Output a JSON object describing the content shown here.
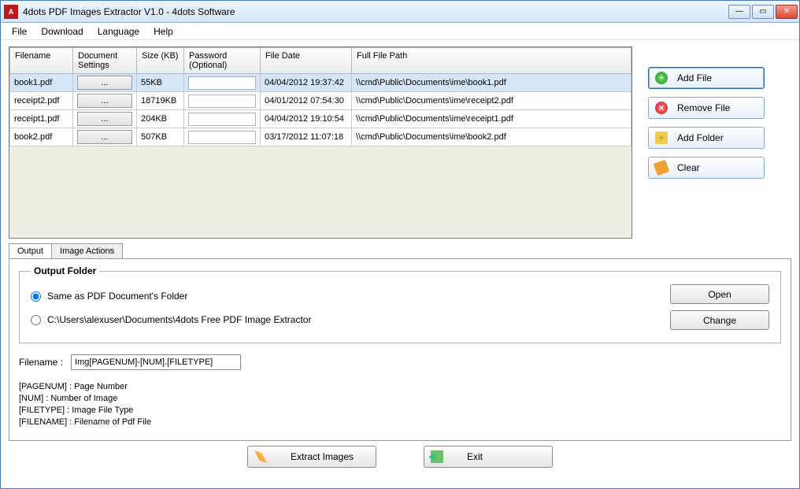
{
  "window": {
    "title": "4dots PDF Images Extractor V1.0 - 4dots Software",
    "icon_text": "A"
  },
  "menu": [
    "File",
    "Download",
    "Language",
    "Help"
  ],
  "grid": {
    "headers": {
      "filename": "Filename",
      "docsettings": "Document Settings",
      "size": "Size (KB)",
      "password": "Password (Optional)",
      "filedate": "File Date",
      "fullpath": "Full File Path"
    },
    "docsettings_btn": "...",
    "rows": [
      {
        "filename": "book1.pdf",
        "size": "55KB",
        "date": "04/04/2012 19:37:42",
        "path": "\\\\cmd\\Public\\Documents\\ime\\book1.pdf"
      },
      {
        "filename": "receipt2.pdf",
        "size": "18719KB",
        "date": "04/01/2012 07:54:30",
        "path": "\\\\cmd\\Public\\Documents\\ime\\receipt2.pdf"
      },
      {
        "filename": "receipt1.pdf",
        "size": "204KB",
        "date": "04/04/2012 19:10:54",
        "path": "\\\\cmd\\Public\\Documents\\ime\\receipt1.pdf"
      },
      {
        "filename": "book2.pdf",
        "size": "507KB",
        "date": "03/17/2012 11:07:18",
        "path": "\\\\cmd\\Public\\Documents\\ime\\book2.pdf"
      }
    ]
  },
  "sidebuttons": {
    "add_file": "Add File",
    "remove_file": "Remove File",
    "add_folder": "Add Folder",
    "clear": "Clear"
  },
  "tabs": {
    "output": "Output",
    "image_actions": "Image Actions"
  },
  "output": {
    "legend": "Output Folder",
    "same_as": "Same as PDF Document's Folder",
    "custom_path": "C:\\Users\\alexuser\\Documents\\4dots Free PDF Image Extractor",
    "open": "Open",
    "change": "Change",
    "filename_label": "Filename :",
    "filename_value": "Img[PAGENUM]-[NUM].[FILETYPE]",
    "hints": [
      "[PAGENUM] : Page Number",
      "[NUM] : Number of Image",
      "[FILETYPE] : Image File Type",
      "[FILENAME] : Filename of Pdf File"
    ]
  },
  "bottom": {
    "extract": "Extract Images",
    "exit": "Exit"
  }
}
